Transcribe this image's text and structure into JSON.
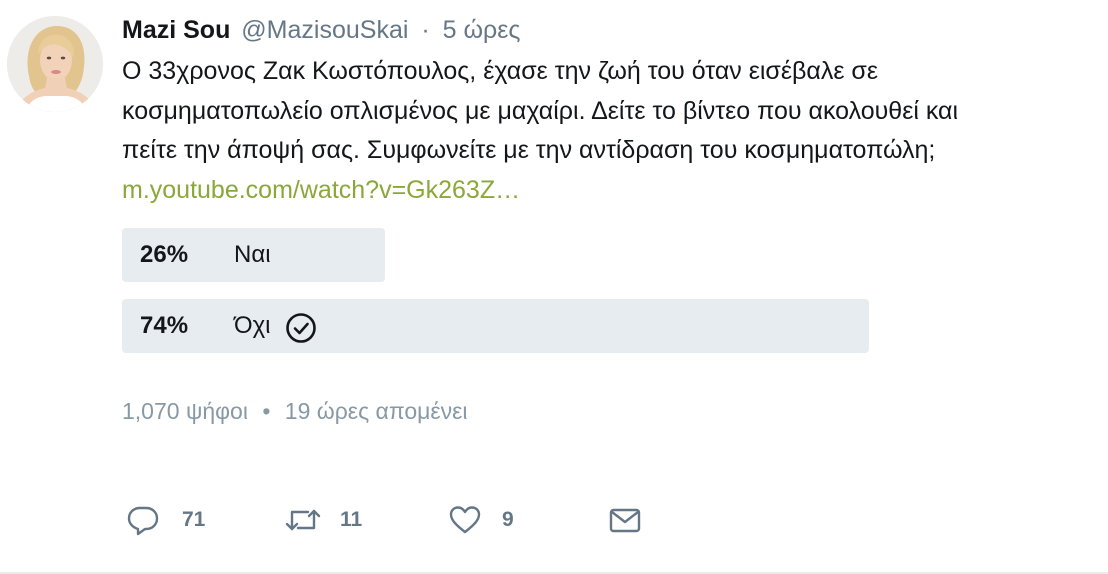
{
  "tweet": {
    "display_name": "Mazi Sou",
    "handle": "@MazisouSkai",
    "separator": "·",
    "time": "5 ώρες",
    "text_lines": [
      "Ο 33χρονος Ζακ Κωστόπουλος, έχασε την ζωή του όταν εισέβαλε σε",
      "κοσμηματοπωλείο οπλισμένος με μαχαίρι. Δείτε το βίντεο που ακολουθεί και",
      "πείτε την άποψή σας. Συμφωνείτε με την αντίδραση του κοσμηματοπώλη;"
    ],
    "link": "m.youtube.com/watch?v=Gk263Z…"
  },
  "poll": {
    "options": [
      {
        "percent_label": "26%",
        "percent": 26,
        "label": "Ναι",
        "winner": false
      },
      {
        "percent_label": "74%",
        "percent": 74,
        "label": "Όχι",
        "winner": true
      }
    ],
    "votes": "1,070 ψήφοι",
    "separator": "•",
    "remaining": "19 ώρες απομένει"
  },
  "actions": {
    "reply_count": "71",
    "retweet_count": "11",
    "like_count": "9",
    "icons": [
      "reply-icon",
      "retweet-icon",
      "like-icon",
      "message-icon"
    ]
  },
  "colors": {
    "link": "#8aa83a",
    "poll_bar": "#e6ecf0",
    "muted": "#657786",
    "text": "#14171a"
  }
}
